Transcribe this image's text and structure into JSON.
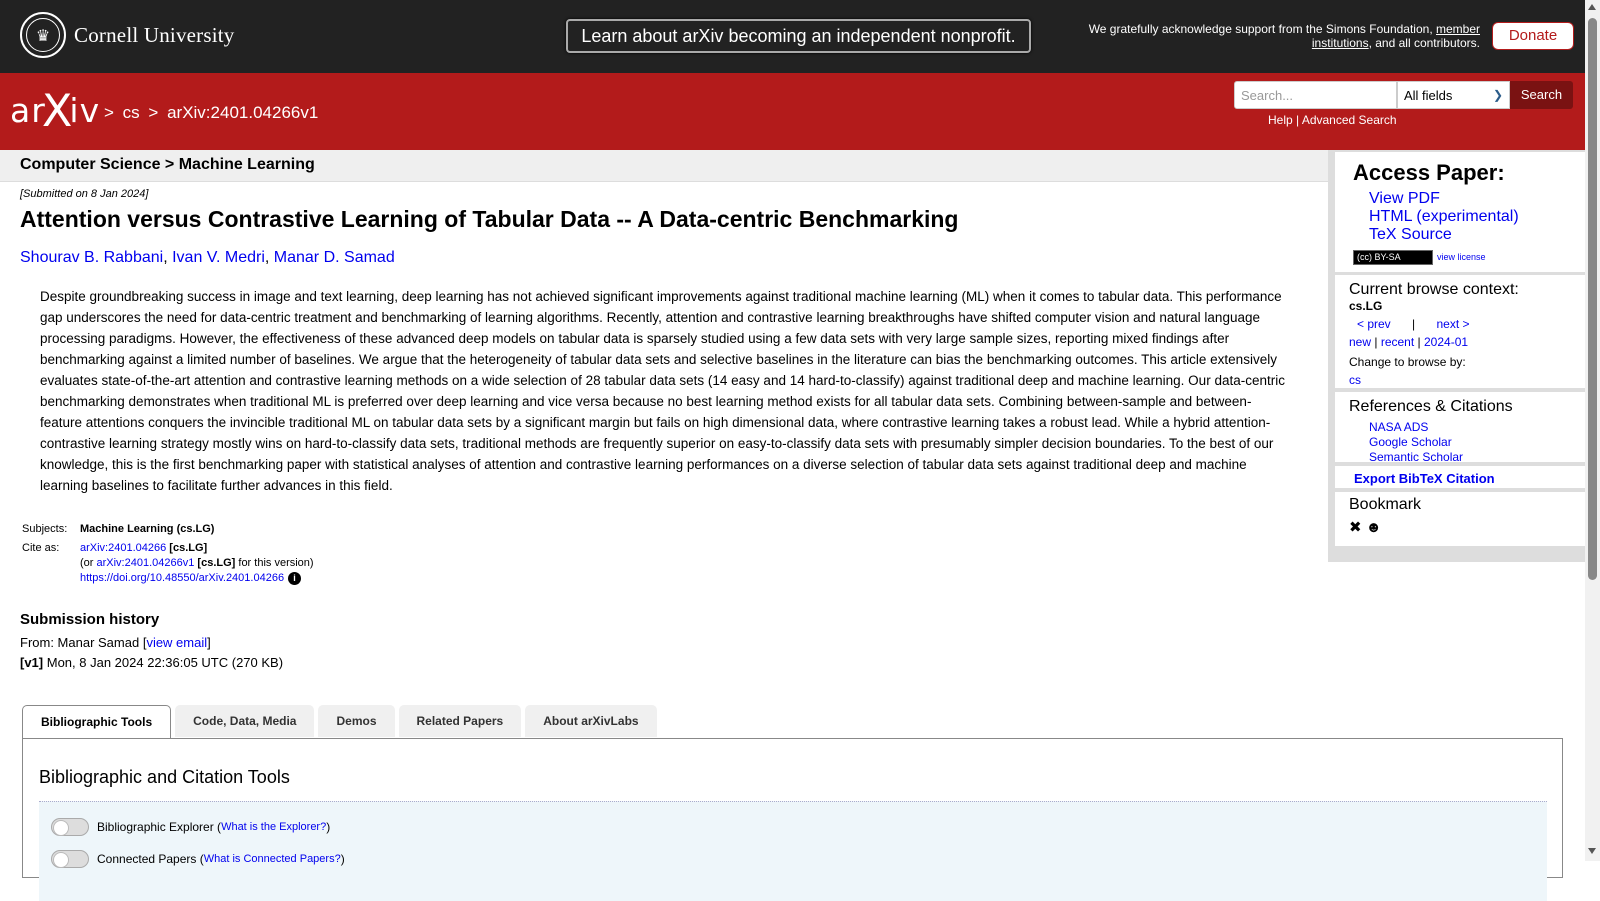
{
  "top": {
    "university": "Cornell University",
    "announcement": "Learn about arXiv becoming an independent nonprofit.",
    "ack_prefix": "We gratefully acknowledge support from the Simons Foundation, ",
    "ack_link": "member institutions",
    "ack_suffix": ", and all contributors.",
    "donate": "Donate"
  },
  "header": {
    "logo": "arXiv",
    "crumbs": [
      ">",
      "cs",
      ">",
      "arXiv:2401.04266v1"
    ],
    "search_placeholder": "Search...",
    "field_select": "All fields",
    "search_button": "Search",
    "help": "Help",
    "sep": "|",
    "advanced": "Advanced Search"
  },
  "paper": {
    "subheader": "Computer Science > Machine Learning",
    "submitted": "[Submitted on 8 Jan 2024]",
    "title": "Attention versus Contrastive Learning of Tabular Data -- A Data-centric Benchmarking",
    "authors": [
      "Shourav B. Rabbani",
      "Ivan V. Medri",
      "Manar D. Samad"
    ],
    "abstract": "Despite groundbreaking success in image and text learning, deep learning has not achieved significant improvements against traditional machine learning (ML) when it comes to tabular data. This performance gap underscores the need for data-centric treatment and benchmarking of learning algorithms. Recently, attention and contrastive learning breakthroughs have shifted computer vision and natural language processing paradigms. However, the effectiveness of these advanced deep models on tabular data is sparsely studied using a few data sets with very large sample sizes, reporting mixed findings after benchmarking against a limited number of baselines. We argue that the heterogeneity of tabular data sets and selective baselines in the literature can bias the benchmarking outcomes. This article extensively evaluates state-of-the-art attention and contrastive learning methods on a wide selection of 28 tabular data sets (14 easy and 14 hard-to-classify) against traditional deep and machine learning. Our data-centric benchmarking demonstrates when traditional ML is preferred over deep learning and vice versa because no best learning method exists for all tabular data sets. Combining between-sample and between-feature attentions conquers the invincible traditional ML on tabular data sets by a significant margin but fails on high dimensional data, where contrastive learning takes a robust lead. While a hybrid attention-contrastive learning strategy mostly wins on hard-to-classify data sets, traditional methods are frequently superior on easy-to-classify data sets with presumably simpler decision boundaries. To the best of our knowledge, this is the first benchmarking paper with statistical analyses of attention and contrastive learning performances on a diverse selection of tabular data sets against traditional deep and machine learning baselines to facilitate further advances in this field.",
    "subjects_label": "Subjects:",
    "subjects_value": "Machine Learning (cs.LG)",
    "cite_label": "Cite as:",
    "cite_link": "arXiv:2401.04266",
    "cite_cat": "[cs.LG]",
    "cite_or_prefix": "(or ",
    "cite_version_link": "arXiv:2401.04266v1",
    "cite_version_cat": "[cs.LG]",
    "cite_version_suffix": " for this version)",
    "doi": "https://doi.org/10.48550/arXiv.2401.04266",
    "history_heading": "Submission history",
    "from_prefix": "From: Manar Samad [",
    "view_email": "view email",
    "from_suffix": "]",
    "v1_label": "[v1]",
    "v1_text": " Mon, 8 Jan 2024 22:36:05 UTC (270 KB)"
  },
  "tabs": [
    "Bibliographic Tools",
    "Code, Data, Media",
    "Demos",
    "Related Papers",
    "About arXivLabs"
  ],
  "panel": {
    "title": "Bibliographic and Citation Tools",
    "explorer_label": "Bibliographic Explorer (",
    "explorer_link": "What is the Explorer?",
    "explorer_close": ")",
    "connected_label": "Connected Papers (",
    "connected_link": "What is Connected Papers?",
    "connected_close": ")"
  },
  "sidebar": {
    "access_heading": "Access Paper:",
    "view_pdf": "View PDF",
    "html": "HTML (experimental)",
    "tex": "TeX Source",
    "license_badge": "(cc) BY-SA",
    "view_license": "view license",
    "browse_heading": "Current browse context:",
    "browse_ctx": "cs.LG",
    "prev": "< prev",
    "pipe": "|",
    "next": "next >",
    "new": "new",
    "recent": "recent",
    "month": "2024-01",
    "change_browse": "Change to browse by:",
    "cs": "cs",
    "refs_heading": "References & Citations",
    "nasa": "NASA ADS",
    "scholar": "Google Scholar",
    "semantic": "Semantic Scholar",
    "bibtex": "Export BibTeX Citation",
    "bookmark_heading": "Bookmark"
  }
}
